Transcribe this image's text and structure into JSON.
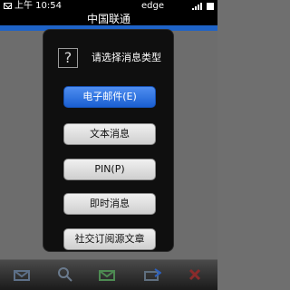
{
  "status_bar": {
    "time": "上午 10:54",
    "network": "edge",
    "icons": [
      "mail-icon",
      "signal-icon",
      "battery-icon"
    ]
  },
  "header": {
    "title": "中国联通"
  },
  "dialog": {
    "help_symbol": "?",
    "prompt": "请选择消息类型",
    "options": [
      {
        "label": "电子邮件(E)",
        "selected": true
      },
      {
        "label": "文本消息",
        "selected": false
      },
      {
        "label": "PIN(P)",
        "selected": false
      },
      {
        "label": "即时消息",
        "selected": false
      },
      {
        "label": "社交订阅源文章",
        "selected": false
      }
    ]
  },
  "toolbar": {
    "icons": [
      "compose-icon",
      "search-icon",
      "mail-icon",
      "forward-icon",
      "delete-icon"
    ]
  },
  "colors": {
    "accent_blue": "#1a5fd2",
    "dialog_bg": "#0f0f0f",
    "toolbar_bg": "#1b1b1b"
  }
}
